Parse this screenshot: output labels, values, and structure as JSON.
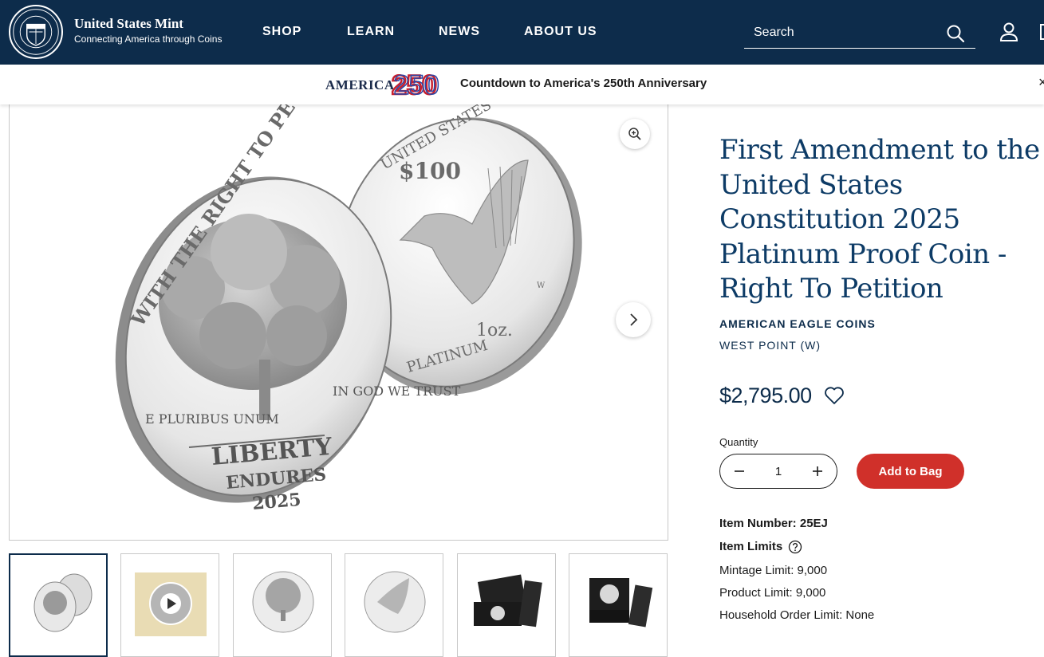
{
  "header": {
    "brand_name": "United States Mint",
    "brand_tagline": "Connecting America through Coins",
    "seal_text": "TREASURY · UNITED STATES MINT",
    "nav": [
      "SHOP",
      "LEARN",
      "NEWS",
      "ABOUT US"
    ],
    "search_placeholder": "Search",
    "icons": [
      "search-icon",
      "account-icon",
      "shopping-bag-icon"
    ]
  },
  "banner": {
    "logo_word": "AMERICA",
    "logo_number": "250",
    "text": "Countdown to America's 250th Anniversary",
    "close_glyph": "×"
  },
  "gallery": {
    "coin_reverse_text": [
      "WITH THE RIGHT TO PETITION",
      "E PLURIBUS UNUM",
      "IN GOD WE TRUST",
      "LIBERTY",
      "ENDURES",
      "2025"
    ],
    "coin_obverse_text": [
      "UNITED STATES OF AMERICA",
      "$100",
      "1oz.",
      "PLATINUM",
      "W"
    ],
    "thumbnails": [
      "coin-pair",
      "video",
      "coin-reverse",
      "coin-obverse",
      "packaging-open",
      "packaging-case"
    ],
    "active_thumbnail": 0
  },
  "product": {
    "title": "First Amendment to the United States Constitution 2025 Platinum Proof Coin - Right To Petition",
    "category": "AMERICAN EAGLE COINS",
    "mint": "WEST POINT (W)",
    "price": "$2,795.00",
    "quantity_label": "Quantity",
    "quantity": "1",
    "add_to_bag": "Add to Bag",
    "item_number_label": "Item Number:",
    "item_number": "25EJ",
    "item_limits_label": "Item Limits",
    "mintage_limit": "Mintage Limit: 9,000",
    "product_limit": "Product Limit: 9,000",
    "household_limit": "Household Order Limit: None"
  },
  "colors": {
    "navy": "#0d2c4b",
    "title_blue": "#0d3b66",
    "add_button_red": "#d0302a"
  }
}
